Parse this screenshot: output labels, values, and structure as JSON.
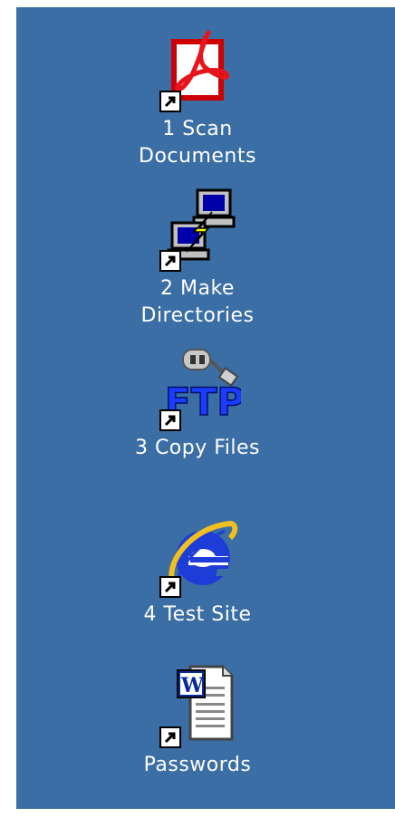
{
  "desktop": {
    "background_color": "#3a6ea5",
    "icons": [
      {
        "line1": "1 Scan",
        "line2": "Documents",
        "icon": "acrobat-reader-icon"
      },
      {
        "line1": "2 Make",
        "line2": "Directories",
        "icon": "network-computers-icon"
      },
      {
        "line1": "3 Copy Files",
        "line2": "",
        "icon": "ftp-icon"
      },
      {
        "line1": "4 Test Site",
        "line2": "",
        "icon": "internet-explorer-icon"
      },
      {
        "line1": "Passwords",
        "line2": "",
        "icon": "word-document-icon"
      }
    ]
  }
}
